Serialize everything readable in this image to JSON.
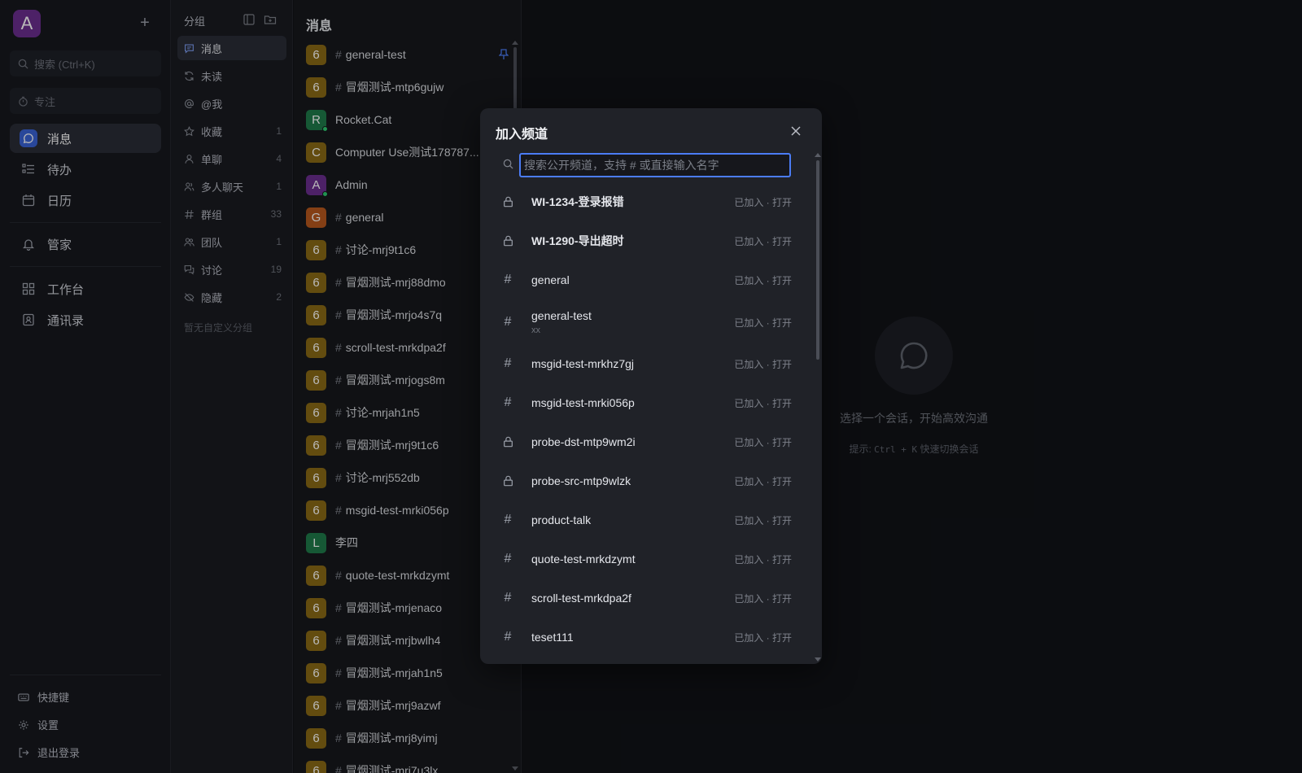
{
  "workspace": {
    "avatar_letter": "A",
    "avatar_color": "#6b2e8f"
  },
  "sidebar": {
    "search_placeholder": "搜索 (Ctrl+K)",
    "focus_label": "专注",
    "nav": [
      {
        "label": "消息",
        "icon": "message-icon",
        "active": true
      },
      {
        "label": "待办",
        "icon": "todo-icon"
      },
      {
        "label": "日历",
        "icon": "calendar-icon"
      },
      {
        "label": "管家",
        "icon": "bell-icon"
      },
      {
        "label": "工作台",
        "icon": "grid-icon"
      },
      {
        "label": "通讯录",
        "icon": "contacts-icon"
      }
    ],
    "footer": [
      {
        "label": "快捷键",
        "icon": "keyboard-icon"
      },
      {
        "label": "设置",
        "icon": "gear-icon"
      },
      {
        "label": "退出登录",
        "icon": "logout-icon"
      }
    ]
  },
  "groups": {
    "title": "分组",
    "items": [
      {
        "label": "消息",
        "count": "",
        "icon": "message-icon",
        "active": true
      },
      {
        "label": "未读",
        "count": "",
        "icon": "refresh-icon"
      },
      {
        "label": "@我",
        "count": "",
        "icon": "at-icon"
      },
      {
        "label": "收藏",
        "count": "1",
        "icon": "star-icon"
      },
      {
        "label": "单聊",
        "count": "4",
        "icon": "user-icon"
      },
      {
        "label": "多人聊天",
        "count": "1",
        "icon": "users-icon"
      },
      {
        "label": "群组",
        "count": "33",
        "icon": "hash-icon"
      },
      {
        "label": "团队",
        "count": "1",
        "icon": "team-icon"
      },
      {
        "label": "讨论",
        "count": "19",
        "icon": "discussion-icon"
      },
      {
        "label": "隐藏",
        "count": "2",
        "icon": "eye-off-icon"
      }
    ],
    "empty_custom": "暂无自定义分组"
  },
  "conversations": {
    "title": "消息",
    "items": [
      {
        "avatar": "6",
        "color": "#8a6a16",
        "hash": true,
        "name": "general-test",
        "pinned": true
      },
      {
        "avatar": "6",
        "color": "#8a6a16",
        "hash": true,
        "name": "冒烟测试-mtp6gujw"
      },
      {
        "avatar": "R",
        "color": "#1f7a4a",
        "hash": false,
        "name": "Rocket.Cat",
        "online": true
      },
      {
        "avatar": "C",
        "color": "#8a6a16",
        "hash": false,
        "name": "Computer Use测试178787..."
      },
      {
        "avatar": "A",
        "color": "#6b2e8f",
        "hash": false,
        "name": "Admin",
        "online": true
      },
      {
        "avatar": "G",
        "color": "#b8581e",
        "hash": true,
        "name": "general"
      },
      {
        "avatar": "6",
        "color": "#8a6a16",
        "hash": true,
        "name": "讨论-mrj9t1c6"
      },
      {
        "avatar": "6",
        "color": "#8a6a16",
        "hash": true,
        "name": "冒烟测试-mrj88dmo"
      },
      {
        "avatar": "6",
        "color": "#8a6a16",
        "hash": true,
        "name": "冒烟测试-mrjo4s7q"
      },
      {
        "avatar": "6",
        "color": "#8a6a16",
        "hash": true,
        "name": "scroll-test-mrkdpa2f"
      },
      {
        "avatar": "6",
        "color": "#8a6a16",
        "hash": true,
        "name": "冒烟测试-mrjogs8m"
      },
      {
        "avatar": "6",
        "color": "#8a6a16",
        "hash": true,
        "name": "讨论-mrjah1n5"
      },
      {
        "avatar": "6",
        "color": "#8a6a16",
        "hash": true,
        "name": "冒烟测试-mrj9t1c6"
      },
      {
        "avatar": "6",
        "color": "#8a6a16",
        "hash": true,
        "name": "讨论-mrj552db"
      },
      {
        "avatar": "6",
        "color": "#8a6a16",
        "hash": true,
        "name": "msgid-test-mrki056p"
      },
      {
        "avatar": "L",
        "color": "#1f7a4a",
        "hash": false,
        "name": "李四"
      },
      {
        "avatar": "6",
        "color": "#8a6a16",
        "hash": true,
        "name": "quote-test-mrkdzymt"
      },
      {
        "avatar": "6",
        "color": "#8a6a16",
        "hash": true,
        "name": "冒烟测试-mrjenaco"
      },
      {
        "avatar": "6",
        "color": "#8a6a16",
        "hash": true,
        "name": "冒烟测试-mrjbwlh4"
      },
      {
        "avatar": "6",
        "color": "#8a6a16",
        "hash": true,
        "name": "冒烟测试-mrjah1n5"
      },
      {
        "avatar": "6",
        "color": "#8a6a16",
        "hash": true,
        "name": "冒烟测试-mrj9azwf"
      },
      {
        "avatar": "6",
        "color": "#8a6a16",
        "hash": true,
        "name": "冒烟测试-mrj8yimj"
      },
      {
        "avatar": "6",
        "color": "#8a6a16",
        "hash": true,
        "name": "冒烟测试-mrj7u3lx"
      }
    ]
  },
  "main": {
    "empty_text": "选择一个会话，开始高效沟通",
    "hint_prefix": "提示:",
    "hint_keys": "Ctrl + K",
    "hint_suffix": "快速切换会话"
  },
  "modal": {
    "title": "加入频道",
    "search_placeholder": "搜索公开频道，支持 # 或直接输入名字",
    "search_value": "",
    "channels": [
      {
        "name": "WI-1234-登录报错",
        "type": "private",
        "status": "已加入 · 打开",
        "sub": ""
      },
      {
        "name": "WI-1290-导出超时",
        "type": "private",
        "status": "已加入 · 打开",
        "sub": ""
      },
      {
        "name": "general",
        "type": "public",
        "status": "已加入 · 打开",
        "sub": ""
      },
      {
        "name": "general-test",
        "type": "public",
        "status": "已加入 · 打开",
        "sub": "xx"
      },
      {
        "name": "msgid-test-mrkhz7gj",
        "type": "public",
        "status": "已加入 · 打开",
        "sub": ""
      },
      {
        "name": "msgid-test-mrki056p",
        "type": "public",
        "status": "已加入 · 打开",
        "sub": ""
      },
      {
        "name": "probe-dst-mtp9wm2i",
        "type": "private",
        "status": "已加入 · 打开",
        "sub": ""
      },
      {
        "name": "probe-src-mtp9wlzk",
        "type": "private",
        "status": "已加入 · 打开",
        "sub": ""
      },
      {
        "name": "product-talk",
        "type": "public",
        "status": "已加入 · 打开",
        "sub": ""
      },
      {
        "name": "quote-test-mrkdzymt",
        "type": "public",
        "status": "已加入 · 打开",
        "sub": ""
      },
      {
        "name": "scroll-test-mrkdpa2f",
        "type": "public",
        "status": "已加入 · 打开",
        "sub": ""
      },
      {
        "name": "teset111",
        "type": "public",
        "status": "已加入 · 打开",
        "sub": ""
      }
    ]
  }
}
